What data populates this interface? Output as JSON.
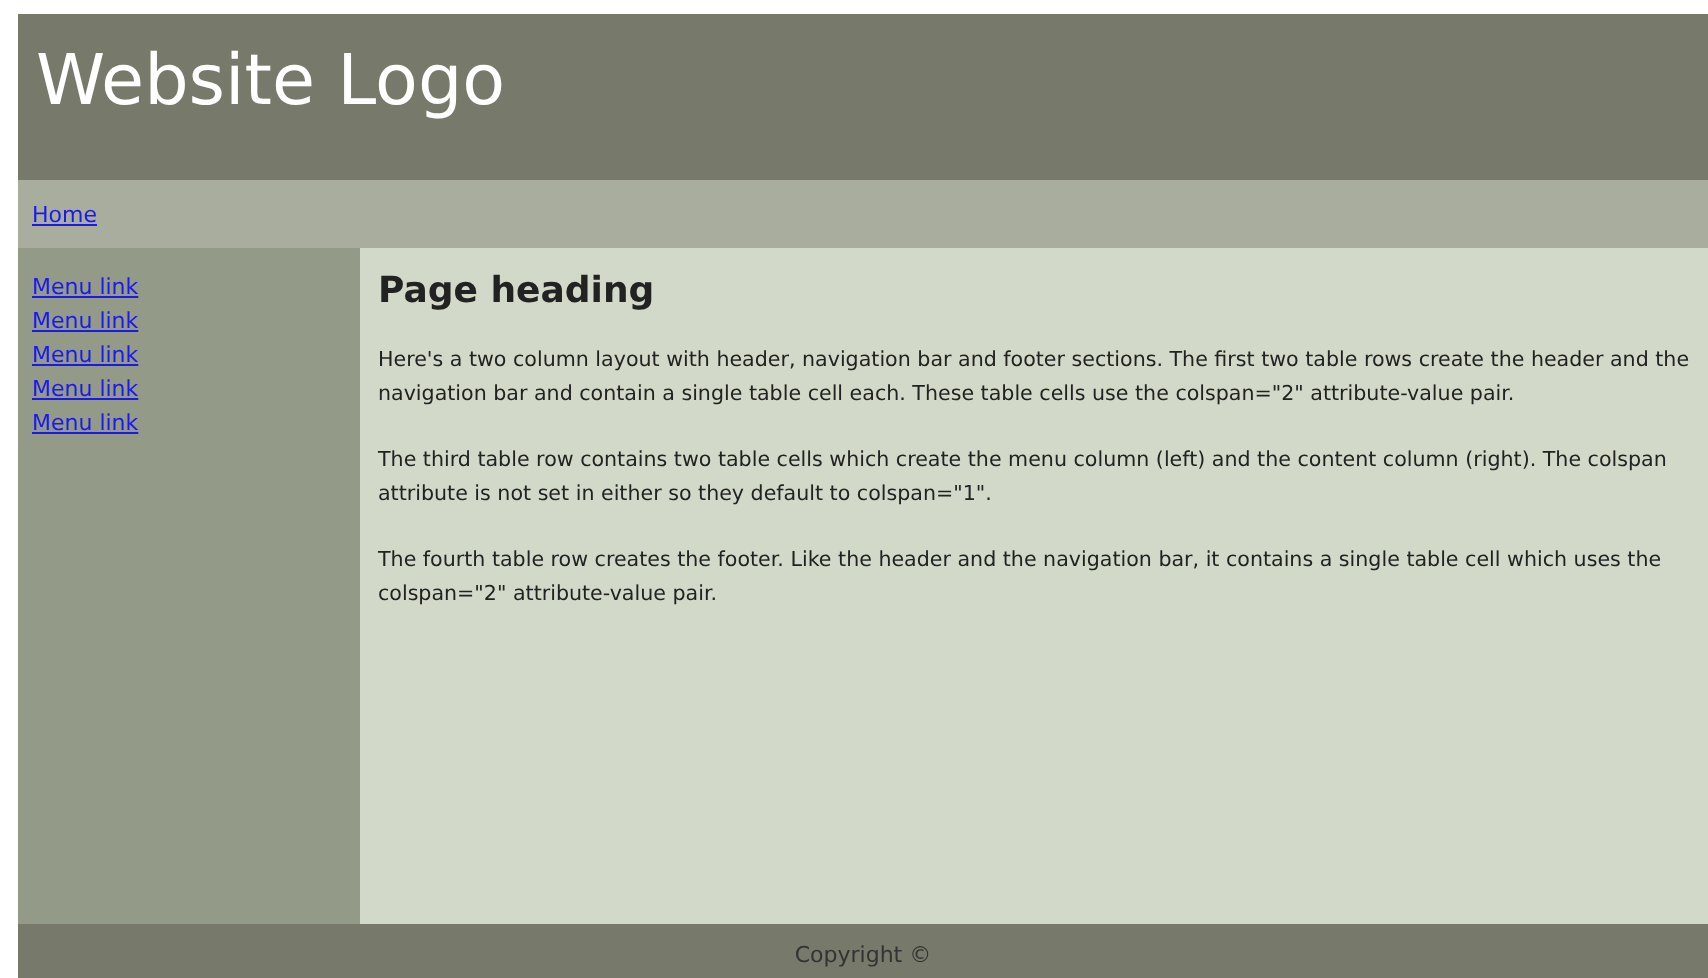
{
  "header": {
    "logo": "Website Logo"
  },
  "nav": {
    "links": [
      "Home"
    ]
  },
  "menu": {
    "links": [
      "Menu link",
      "Menu link",
      "Menu link",
      "Menu link",
      "Menu link"
    ]
  },
  "content": {
    "heading": "Page heading",
    "paragraphs": [
      "Here's a two column layout with header, navigation bar and footer sections. The first two table rows create the header and the navigation bar and contain a single table cell each. These table cells use the colspan=\"2\" attribute-value pair.",
      "The third table row contains two table cells which create the menu column (left) and the content column (right). The colspan attribute is not set in either so they default to colspan=\"1\".",
      "The fourth table row creates the footer. Like the header and the navigation bar, it contains a single table cell which uses the colspan=\"2\" attribute-value pair."
    ]
  },
  "footer": {
    "text": "Copyright ©"
  }
}
